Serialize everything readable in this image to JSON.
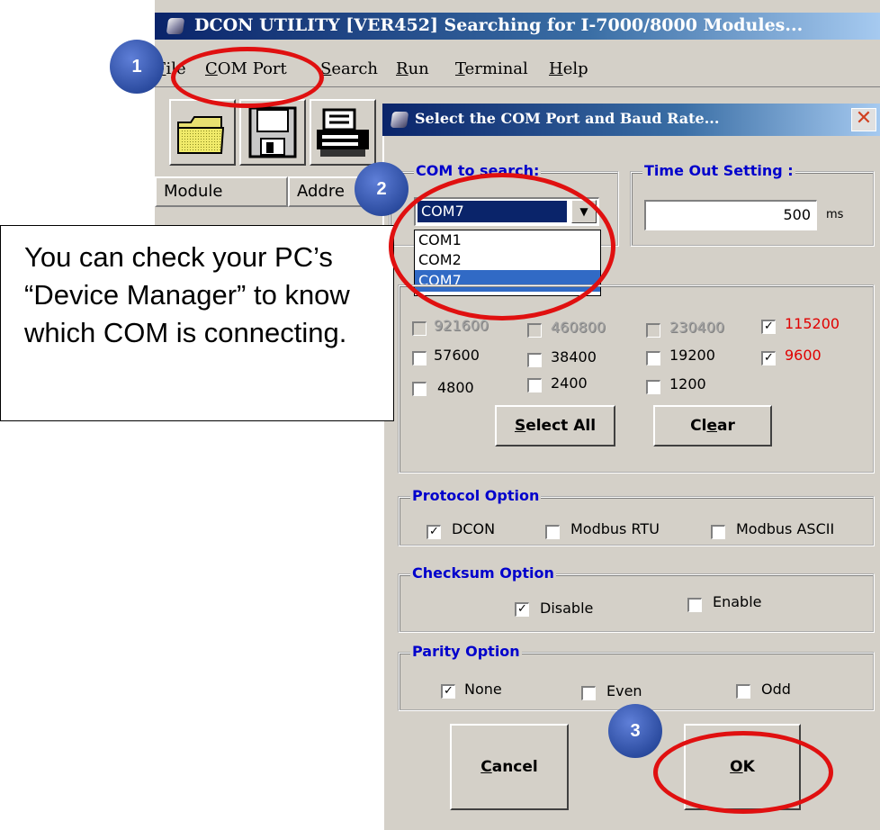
{
  "main_window": {
    "title": "DCON UTILITY [VER452] Searching for I-7000/8000 Modules...",
    "menu": [
      {
        "label": "File",
        "hot": "F",
        "rest": "ile"
      },
      {
        "label": "COM Port",
        "hot": "C",
        "rest": "OM Port"
      },
      {
        "label": "Search",
        "hot": "S",
        "rest": "earch"
      },
      {
        "label": "Run",
        "hot": "R",
        "rest": "un"
      },
      {
        "label": "Terminal",
        "hot": "T",
        "rest": "erminal"
      },
      {
        "label": "Help",
        "hot": "H",
        "rest": "elp"
      }
    ],
    "toolbar_icons": [
      "open-folder-icon",
      "save-disk-icon",
      "print-icon"
    ],
    "columns": [
      "Module",
      "Addre"
    ]
  },
  "dialog": {
    "title": "Select the COM Port and Baud Rate...",
    "com_group_label": "COM to search:",
    "com_selected": "COM7",
    "com_options": [
      "COM1",
      "COM2",
      "COM7"
    ],
    "timeout_label": "Time Out Setting :",
    "timeout_value": "500",
    "timeout_unit": "ms",
    "baud_rates": [
      {
        "label": "921600",
        "checked": false,
        "disabled": true
      },
      {
        "label": "460800",
        "checked": false,
        "disabled": true
      },
      {
        "label": "230400",
        "checked": false,
        "disabled": true
      },
      {
        "label": "115200",
        "checked": true,
        "disabled": false,
        "color": "#e00000"
      },
      {
        "label": "57600",
        "checked": false,
        "disabled": false
      },
      {
        "label": "38400",
        "checked": false,
        "disabled": false
      },
      {
        "label": "19200",
        "checked": false,
        "disabled": false
      },
      {
        "label": "9600",
        "checked": true,
        "disabled": false,
        "color": "#e00000"
      },
      {
        "label": "4800",
        "checked": false,
        "disabled": false
      },
      {
        "label": "2400",
        "checked": false,
        "disabled": false
      },
      {
        "label": "1200",
        "checked": false,
        "disabled": false
      }
    ],
    "select_all": {
      "hot": "S",
      "rest": "elect  All"
    },
    "clear": {
      "pre": "Cl",
      "hot": "e",
      "rest": "ar"
    },
    "protocol_label": "Protocol Option",
    "protocol": [
      {
        "label": "DCON",
        "checked": true
      },
      {
        "label": "Modbus RTU",
        "checked": false
      },
      {
        "label": "Modbus ASCII",
        "checked": false
      }
    ],
    "checksum_label": "Checksum  Option",
    "checksum": [
      {
        "label": "Disable",
        "checked": true
      },
      {
        "label": "Enable",
        "checked": false
      }
    ],
    "parity_label": "Parity Option",
    "parity": [
      {
        "label": "None",
        "checked": true
      },
      {
        "label": "Even",
        "checked": false
      },
      {
        "label": "Odd",
        "checked": false
      }
    ],
    "cancel": {
      "hot": "C",
      "rest": "ancel"
    },
    "ok": {
      "hot": "O",
      "rest": "K"
    }
  },
  "annotations": {
    "step1": "1",
    "step2": "2",
    "step3": "3",
    "callout": "You can check your PC’s “Device Manager” to know which COM is connecting.",
    "highlight_color": "#e01010",
    "accent": "#2c4ca0"
  }
}
